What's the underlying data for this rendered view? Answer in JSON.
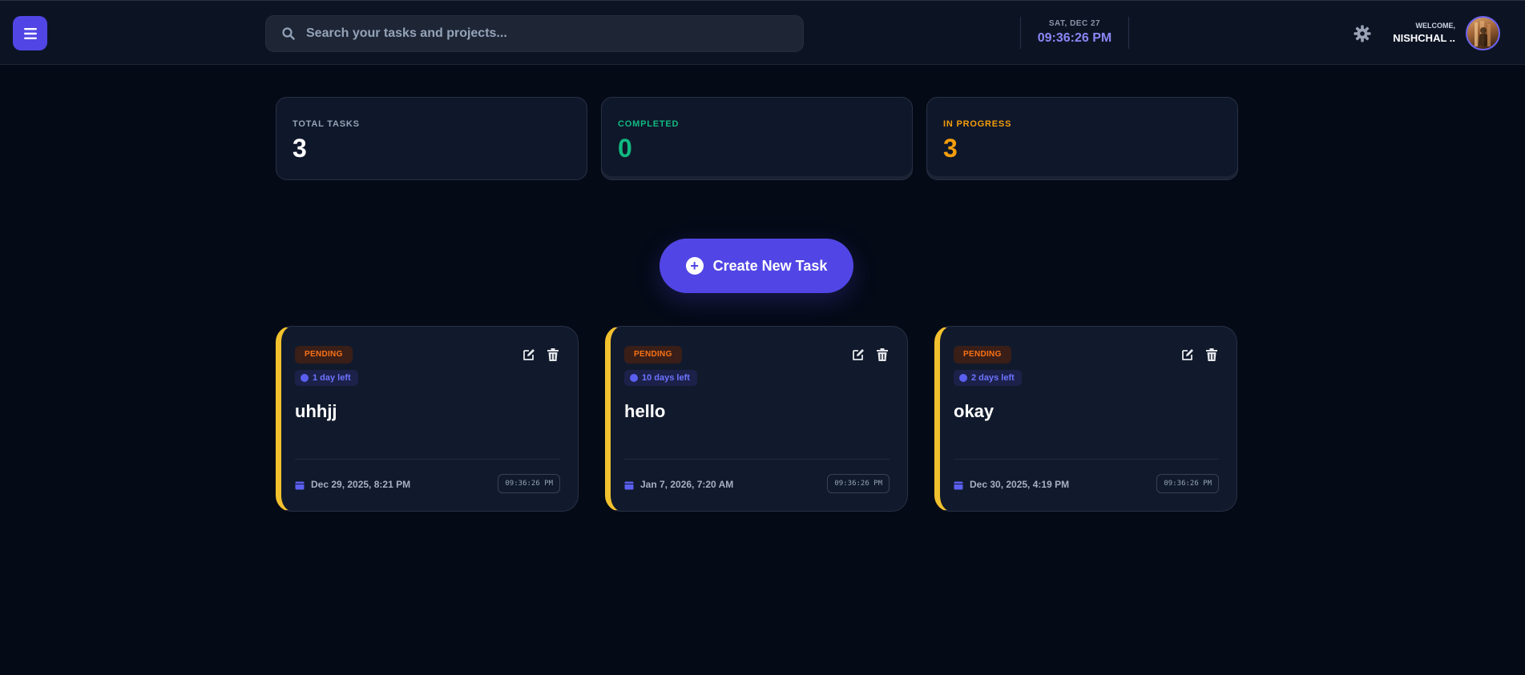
{
  "header": {
    "search_placeholder": "Search your tasks and projects...",
    "date": "SAT, DEC 27",
    "time": "09:36:26 PM",
    "welcome_label": "WELCOME,",
    "user_name": "NISHCHAL ..",
    "accent": "#5146e5"
  },
  "stats": [
    {
      "label": "TOTAL TASKS",
      "value": "3",
      "color": "#ffffff",
      "label_color": "#94a3b8"
    },
    {
      "label": "COMPLETED",
      "value": "0",
      "color": "#10b981",
      "label_color": "#10b981"
    },
    {
      "label": "IN PROGRESS",
      "value": "3",
      "color": "#f59e0b",
      "label_color": "#f59e0b"
    }
  ],
  "create_button": {
    "label": "Create New Task"
  },
  "tasks": [
    {
      "status": "PENDING",
      "due": "1 day left",
      "title": "uhhjj",
      "created": "Dec 29, 2025, 8:21 PM",
      "time": "09:36:26 PM"
    },
    {
      "status": "PENDING",
      "due": "10 days left",
      "title": "hello",
      "created": "Jan 7, 2026, 7:20 AM",
      "time": "09:36:26 PM"
    },
    {
      "status": "PENDING",
      "due": "2 days left",
      "title": "okay",
      "created": "Dec 30, 2025, 4:19 PM",
      "time": "09:36:26 PM"
    }
  ]
}
